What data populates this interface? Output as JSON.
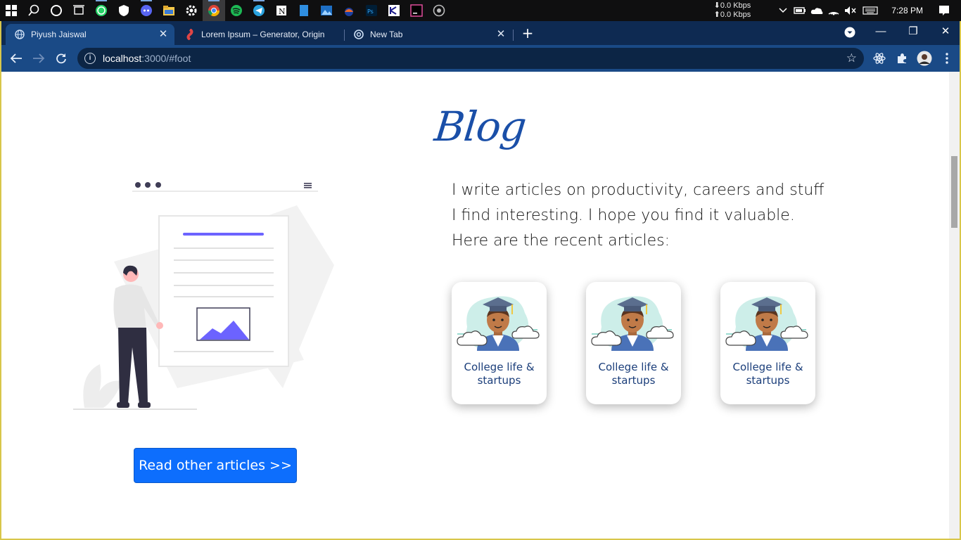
{
  "taskbar": {
    "net_down": "⬇0.0 Kbps",
    "net_up": "⬆0.0 Kbps",
    "time": "7:28 PM"
  },
  "browser": {
    "tabs": [
      {
        "title": "Piyush Jaiswal",
        "active": true
      },
      {
        "title": "Lorem Ipsum – Generator, Origin",
        "active": false
      },
      {
        "title": "New Tab",
        "active": false
      }
    ],
    "url_host": "localhost",
    "url_rest": ":3000/#foot",
    "accent_color": "#1a4a86"
  },
  "page": {
    "blog_title": "Blog",
    "intro": "I write articles on productivity, careers and stuff I find interesting. I hope you find it valuable. Here are the recent articles:",
    "cards": [
      {
        "title": "College life & startups"
      },
      {
        "title": "College life & startups"
      },
      {
        "title": "College life & startups"
      }
    ],
    "read_button": "Read other articles >>",
    "button_color": "#0d6efd",
    "title_color": "#1a4fa8"
  }
}
